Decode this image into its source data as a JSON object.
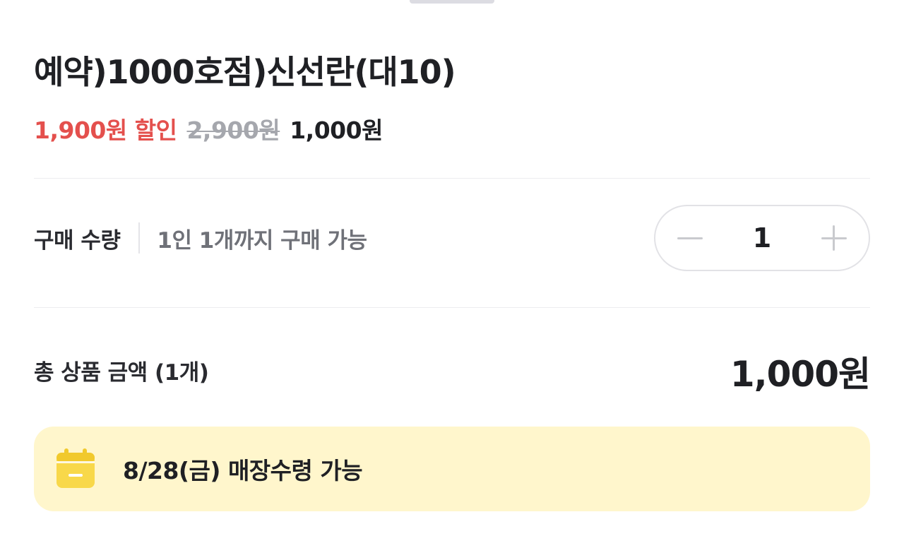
{
  "product": {
    "title": "예약)1000호점)신선란(대10)"
  },
  "price": {
    "discount": "1,900원 할인",
    "original": "2,900원",
    "final": "1,000원"
  },
  "quantity": {
    "label": "구매 수량",
    "limit_note": "1인 1개까지 구매 가능",
    "value": "1",
    "decrease_icon": "minus-icon",
    "increase_icon": "plus-icon"
  },
  "total": {
    "label": "총 상품 금액 (1개)",
    "value": "1,000원"
  },
  "pickup": {
    "icon": "calendar-icon",
    "text": "8/28(금) 매장수령 가능"
  },
  "colors": {
    "discount_red": "#e4504d",
    "strikethrough_gray": "#a5a7ad",
    "banner_yellow": "#fff6cc",
    "calendar_yellow": "#f8d84a"
  }
}
